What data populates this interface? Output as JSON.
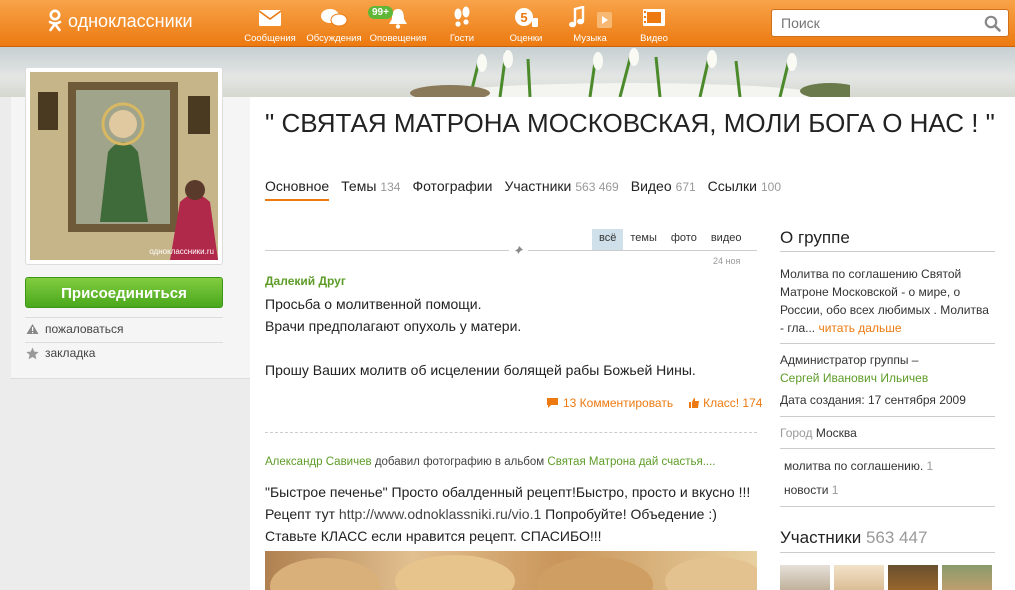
{
  "header": {
    "logo_text": "одноклассники",
    "nav": [
      {
        "label": "Сообщения",
        "icon": "envelope-icon"
      },
      {
        "label": "Обсуждения",
        "icon": "chat-bubbles-icon"
      },
      {
        "label": "Оповещения",
        "icon": "bell-icon"
      },
      {
        "label": "Гости",
        "icon": "footprints-icon"
      },
      {
        "label": "Оценки",
        "icon": "rating-five-icon"
      },
      {
        "label": "Музыка",
        "icon": "music-note-icon"
      },
      {
        "label": "Видео",
        "icon": "video-icon"
      }
    ],
    "discussions_badge": "99+",
    "search_placeholder": "Поиск"
  },
  "left": {
    "photo_watermark": "одноклассники.ru",
    "join_label": "Присоединиться",
    "report_label": "пожаловаться",
    "bookmark_label": "закладка"
  },
  "group": {
    "title": "\" СВЯТАЯ МАТРОНА МОСКОВСКАЯ, МОЛИ БОГА О НАС ! \""
  },
  "tabs": [
    {
      "label": "Основное",
      "count": ""
    },
    {
      "label": "Темы",
      "count": "134"
    },
    {
      "label": "Фотографии",
      "count": ""
    },
    {
      "label": "Участники",
      "count": "563 469"
    },
    {
      "label": "Видео",
      "count": "671"
    },
    {
      "label": "Ссылки",
      "count": "100"
    }
  ],
  "filters": [
    "всё",
    "темы",
    "фото",
    "видео"
  ],
  "post1": {
    "date": "24 ноя",
    "author": "Далекий Друг",
    "line1": "Просьба о молитвенной помощи.",
    "line2": "Врачи предполагают опухоль у матери.",
    "line3": "Прошу Ваших молитв об исцелении болящей рабы Божьей  Нины.",
    "comments": "13 Комментировать",
    "likes": "Класс! 174"
  },
  "post2": {
    "author": "Александр Савичев",
    "action": "добавил фотографию в альбом",
    "album": "Святая Матрона дай счастья....",
    "text_before": "\"Быстрое печенье\" Просто обалденный рецепт!Быстро, просто и вкусно !!! Рецепт тут ",
    "link": "http://www.odnoklassniki.ru/vio.1",
    "text_after": " Попробуйте! Объедение :) Ставьте КЛАСС если нравится рецепт. СПАСИБО!!!"
  },
  "about": {
    "heading": "О группе",
    "description": "Молитва по соглашению Святой Матроне Московской - о мире, о России, обо всех любимых . Молитва - гла...",
    "read_more": "читать дальше",
    "admin_label": "Администратор группы –",
    "admin_name": "Сергей Иванович Ильичев",
    "created": "Дата создания: 17 сентября 2009",
    "city_label": "Город",
    "city": "Москва",
    "tags": [
      {
        "label": "молитва по соглашению.",
        "count": "1"
      },
      {
        "label": "новости",
        "count": "1"
      }
    ]
  },
  "members": {
    "heading": "Участники",
    "count": "563 447"
  },
  "colors": {
    "brand_orange": "#ec7a10",
    "join_green": "#4aa81c",
    "link_green": "#5e9c28"
  }
}
